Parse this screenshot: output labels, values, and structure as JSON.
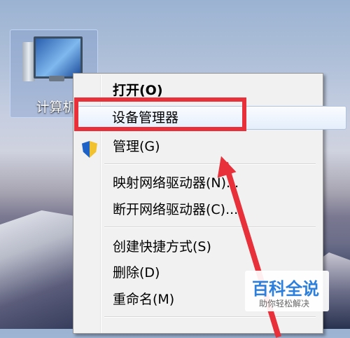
{
  "desktop": {
    "icon_label": "计算机"
  },
  "context_menu": {
    "items": [
      {
        "label": "打开(O)",
        "bold": true
      },
      {
        "label": "设备管理器"
      },
      {
        "label": "管理(G)"
      },
      {
        "label": "映射网络驱动器(N)..."
      },
      {
        "label": "断开网络驱动器(C)..."
      },
      {
        "label": "创建快捷方式(S)"
      },
      {
        "label": "删除(D)"
      },
      {
        "label": "重命名(M)"
      }
    ]
  },
  "watermark": {
    "title": "百科全说",
    "subtitle": "助你轻松解决"
  },
  "icons": {
    "computer": "computer-icon",
    "shield": "uac-shield-icon"
  },
  "colors": {
    "highlight": "#e8303a",
    "brand": "#2c7fdc"
  }
}
